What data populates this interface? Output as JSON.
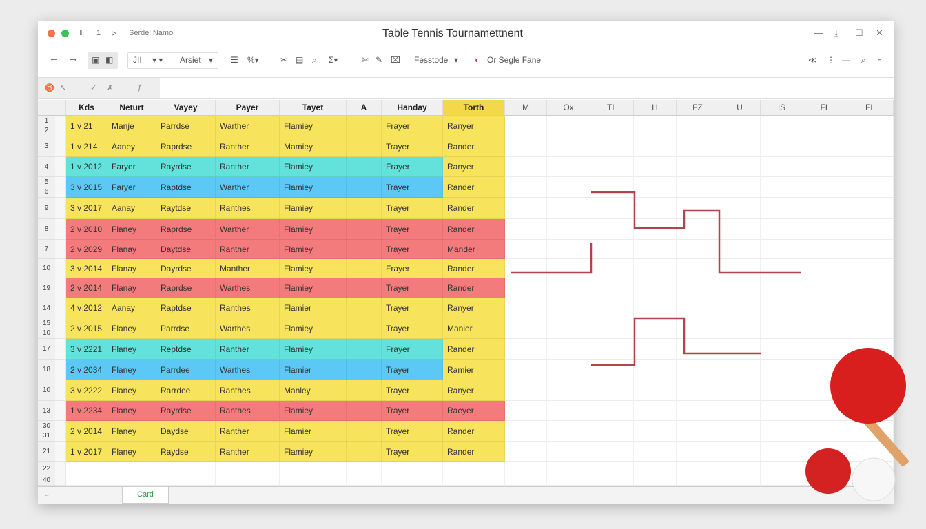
{
  "window": {
    "app_name": "Serdel Namo",
    "title": "Table Tennis Tournamettnent",
    "controls": [
      "—",
      "⤓",
      "☐",
      "✕"
    ]
  },
  "toolbar": {
    "font_size": "JII",
    "font_name": "Arsiet",
    "style": "Fesstode",
    "fill_label": "Or Segle Fane",
    "right_icons": [
      "≪",
      "⋮",
      "—",
      "⌕",
      "⊦"
    ]
  },
  "columns": [
    "Kds",
    "Neturt",
    "Vayey",
    "Payer",
    "Tayet",
    "A",
    "Handay",
    "Torth",
    "M",
    "Ox",
    "TL",
    "H",
    "FZ",
    "U",
    "IS",
    "FL",
    "FL"
  ],
  "colors": {
    "yellow": "#f7e45c",
    "cyan": "#62e2da",
    "blue": "#5cc8f6",
    "red": "#f47b7c",
    "torth_header": "#f5d84a",
    "chart_line": "#b0454d"
  },
  "rows": [
    {
      "labels": [
        "1",
        "2"
      ],
      "color": "yellow",
      "cells": [
        "1 v 21",
        "Manje",
        "Parrdse",
        "Warther",
        "Flamiey",
        "",
        "Frayer",
        "Ranyer"
      ]
    },
    {
      "labels": [
        "3"
      ],
      "color": "yellow",
      "cells": [
        "1 v 214",
        "Aaney",
        "Raprdse",
        "Ranther",
        "Mamiey",
        "",
        "Trayer",
        "Rander"
      ]
    },
    {
      "labels": [
        "4"
      ],
      "color": "cyan",
      "cells": [
        "1 v 2012",
        "Faryer",
        "Rayrdse",
        "Ranther",
        "Flamiey",
        "",
        "Frayer",
        "Ranyer"
      ]
    },
    {
      "labels": [
        "5",
        "6"
      ],
      "color": "blue",
      "cells": [
        "3 v 2015",
        "Faryer",
        "Raptdse",
        "Warther",
        "Flamiey",
        "",
        "Trayer",
        "Rander"
      ]
    },
    {
      "labels": [
        "9"
      ],
      "color": "yellow",
      "cells": [
        "3 v 2017",
        "Aanay",
        "Raytdse",
        "Ranthes",
        "Flamiey",
        "",
        "Trayer",
        "Rander"
      ]
    },
    {
      "labels": [
        "8"
      ],
      "color": "red",
      "cells": [
        "2 v 2010",
        "Flaney",
        "Raprdse",
        "Warther",
        "Flamiey",
        "",
        "Trayer",
        "Rander"
      ]
    },
    {
      "labels": [
        "7"
      ],
      "color": "red",
      "cells": [
        "2 v 2029",
        "Flanay",
        "Daytdse",
        "Ranther",
        "Flamiey",
        "",
        "Trayer",
        "Mander"
      ]
    },
    {
      "labels": [
        "10"
      ],
      "color": "yellow",
      "cells": [
        "3 v 2014",
        "Flanay",
        "Dayrdse",
        "Manther",
        "Flamiey",
        "",
        "Frayer",
        "Rander"
      ]
    },
    {
      "labels": [
        "19"
      ],
      "color": "red",
      "cells": [
        "2 v 2014",
        "Flanay",
        "Raprdse",
        "Warthes",
        "Flamiey",
        "",
        "Trayer",
        "Rander"
      ]
    },
    {
      "labels": [
        "14"
      ],
      "color": "yellow",
      "cells": [
        "4 v 2012",
        "Aanay",
        "Raptdse",
        "Ranthes",
        "Flamier",
        "",
        "Trayer",
        "Ranyer"
      ]
    },
    {
      "labels": [
        "15",
        "10"
      ],
      "color": "yellow",
      "cells": [
        "2 v 2015",
        "Flaney",
        "Parrdse",
        "Warthes",
        "Flamiey",
        "",
        "Trayer",
        "Manier"
      ]
    },
    {
      "labels": [
        "17"
      ],
      "color": "cyan",
      "cells": [
        "3 v 2221",
        "Flaney",
        "Reptdse",
        "Ranther",
        "Flamiey",
        "",
        "Frayer",
        "Rander"
      ]
    },
    {
      "labels": [
        "18"
      ],
      "color": "blue",
      "cells": [
        "2 v 2034",
        "Flaney",
        "Parrdee",
        "Warthes",
        "Flamier",
        "",
        "Trayer",
        "Ramier"
      ]
    },
    {
      "labels": [
        "10"
      ],
      "color": "yellow",
      "cells": [
        "3 v 2222",
        "Flaney",
        "Rarrdee",
        "Ranthes",
        "Manley",
        "",
        "Trayer",
        "Ranyer"
      ]
    },
    {
      "labels": [
        "13"
      ],
      "color": "red",
      "cells": [
        "1 v 2234",
        "Flaney",
        "Rayrdse",
        "Ranthes",
        "Flamiey",
        "",
        "Trayer",
        "Raeyer"
      ]
    },
    {
      "labels": [
        "30",
        "31"
      ],
      "color": "yellow",
      "cells": [
        "2 v 2014",
        "Flaney",
        "Daydse",
        "Ranther",
        "Flamier",
        "",
        "Trayer",
        "Rander"
      ]
    },
    {
      "labels": [
        "21"
      ],
      "color": "yellow",
      "cells": [
        "1 v 2017",
        "Flaney",
        "Raydse",
        "Ranther",
        "Flamiey",
        "",
        "Trayer",
        "Rander"
      ]
    },
    {
      "labels": [
        "22"
      ],
      "color": "",
      "cells": []
    },
    {
      "labels": [
        "40"
      ],
      "color": "",
      "cells": []
    }
  ],
  "sheet_tabs": [
    {
      "label": "Card",
      "active": true
    }
  ]
}
